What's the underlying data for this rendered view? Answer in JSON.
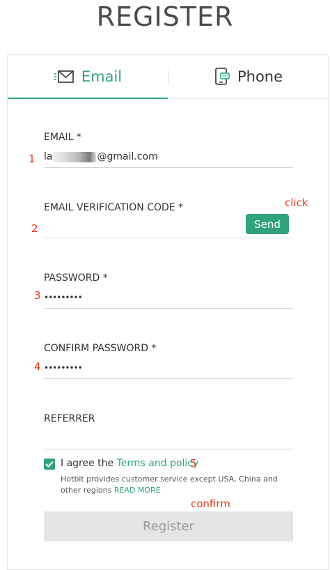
{
  "page": {
    "title": "REGISTER"
  },
  "tabs": [
    {
      "label": "Email",
      "icon": "email-icon",
      "active": true
    },
    {
      "label": "Phone",
      "icon": "phone-icon",
      "active": false
    }
  ],
  "form": {
    "email": {
      "label": "EMAIL *",
      "value_prefix": "la",
      "value_suffix": "@gmail.com"
    },
    "email_code": {
      "label": "EMAIL VERIFICATION CODE *",
      "value": "",
      "send_label": "Send"
    },
    "password": {
      "label": "PASSWORD *",
      "value": "•••••••••"
    },
    "confirm_password": {
      "label": "CONFIRM PASSWORD *",
      "value": "•••••••••"
    },
    "referrer": {
      "label": "REFERRER",
      "value": ""
    },
    "agree": {
      "checked": true,
      "prefix": "I agree the ",
      "link": "Terms and policy"
    },
    "notice": {
      "text": "Hotbit provides customer service except USA, China and other regions ",
      "link": "READ MORE"
    },
    "register_label": "Register"
  },
  "annotations": {
    "m1": "1",
    "m2": "2",
    "m3": "3",
    "m4": "4",
    "m5": "5",
    "click": "click",
    "confirm": "confirm"
  },
  "colors": {
    "accent": "#2fa37e",
    "annotation": "#e8381c",
    "disabled_bg": "#e5e5e5"
  }
}
